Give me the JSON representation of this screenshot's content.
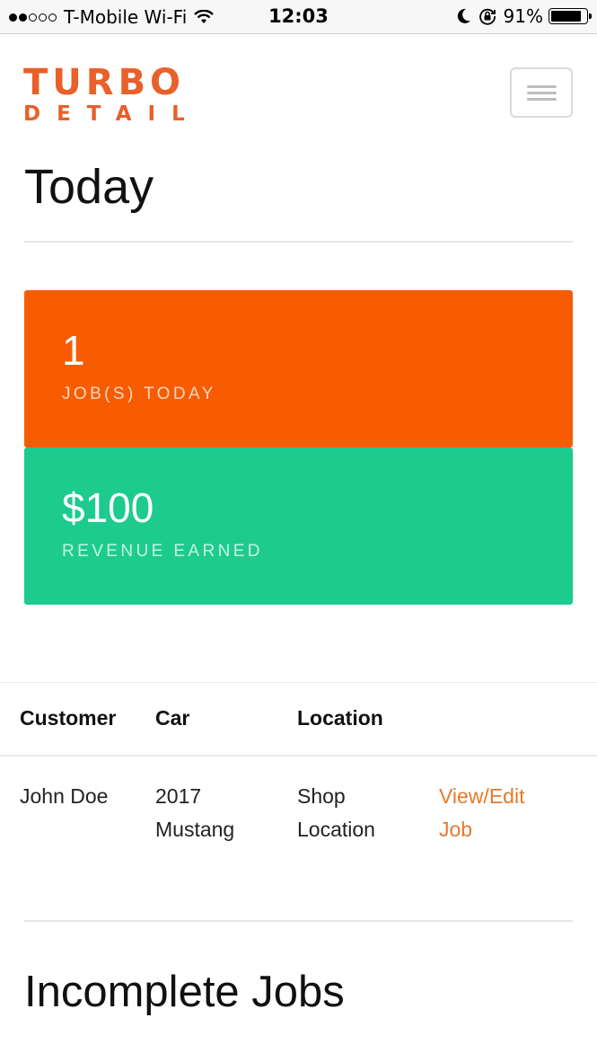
{
  "status_bar": {
    "carrier": "T-Mobile Wi-Fi",
    "time": "12:03",
    "battery_percent": "91%",
    "battery_level": 0.91,
    "signal_bars_filled": 2,
    "signal_bars_total": 5,
    "icons": [
      "wifi-icon",
      "moon-icon",
      "rotation-lock-icon",
      "battery-icon"
    ]
  },
  "header": {
    "logo_line1": "TURBO",
    "logo_line2": "DETAIL",
    "brand_color": "#e8602a",
    "menu_icon": "hamburger-menu-icon"
  },
  "page_title": "Today",
  "stats": {
    "jobs": {
      "value": "1",
      "label": "JOB(S) TODAY",
      "color": "#f75c03"
    },
    "revenue": {
      "value": "$100",
      "label": "REVENUE EARNED",
      "color": "#1ecb8e"
    }
  },
  "table": {
    "columns": [
      "Customer",
      "Car",
      "Location",
      ""
    ],
    "rows": [
      {
        "customer": "John Doe",
        "car_line1": "2017",
        "car_line2": "Mustang",
        "location_line1": "Shop",
        "location_line2": "Location",
        "action_line1": "View/Edit",
        "action_line2": "Job"
      }
    ],
    "link_color": "#e8782a"
  },
  "incomplete_title": "Incomplete Jobs"
}
